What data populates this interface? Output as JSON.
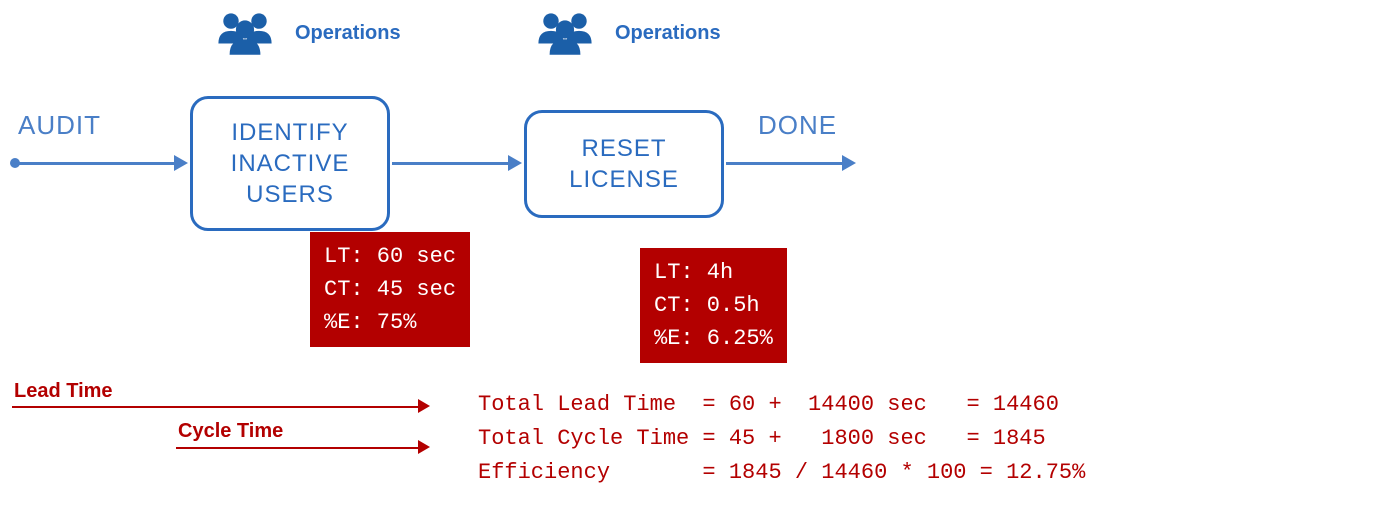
{
  "roles": {
    "ops1": "Operations",
    "ops2": "Operations"
  },
  "flow": {
    "start": "AUDIT",
    "node1": "IDENTIFY\nINACTIVE\nUSERS",
    "node2": "RESET\nLICENSE",
    "end": "DONE"
  },
  "metrics": {
    "box1": "LT: 60 sec\nCT: 45 sec\n%E: 75%",
    "box2": "LT: 4h\nCT: 0.5h\n%E: 6.25%"
  },
  "legend": {
    "lead": "Lead Time",
    "cycle": "Cycle Time"
  },
  "calc": "Total Lead Time  = 60 +  14400 sec   = 14460\nTotal Cycle Time = 45 +   1800 sec   = 1845\nEfficiency       = 1845 / 14460 * 100 = 12.75%",
  "chart_data": {
    "type": "table",
    "title": "Value Stream Map",
    "steps": [
      {
        "name": "IDENTIFY INACTIVE USERS",
        "role": "Operations",
        "lead_time_sec": 60,
        "cycle_time_sec": 45,
        "efficiency_pct": 75
      },
      {
        "name": "RESET LICENSE",
        "role": "Operations",
        "lead_time_sec": 14400,
        "cycle_time_sec": 1800,
        "efficiency_pct": 6.25
      }
    ],
    "totals": {
      "total_lead_time_sec": 14460,
      "total_cycle_time_sec": 1845,
      "overall_efficiency_pct": 12.75,
      "efficiency_formula": "1845 / 14460 * 100"
    }
  }
}
